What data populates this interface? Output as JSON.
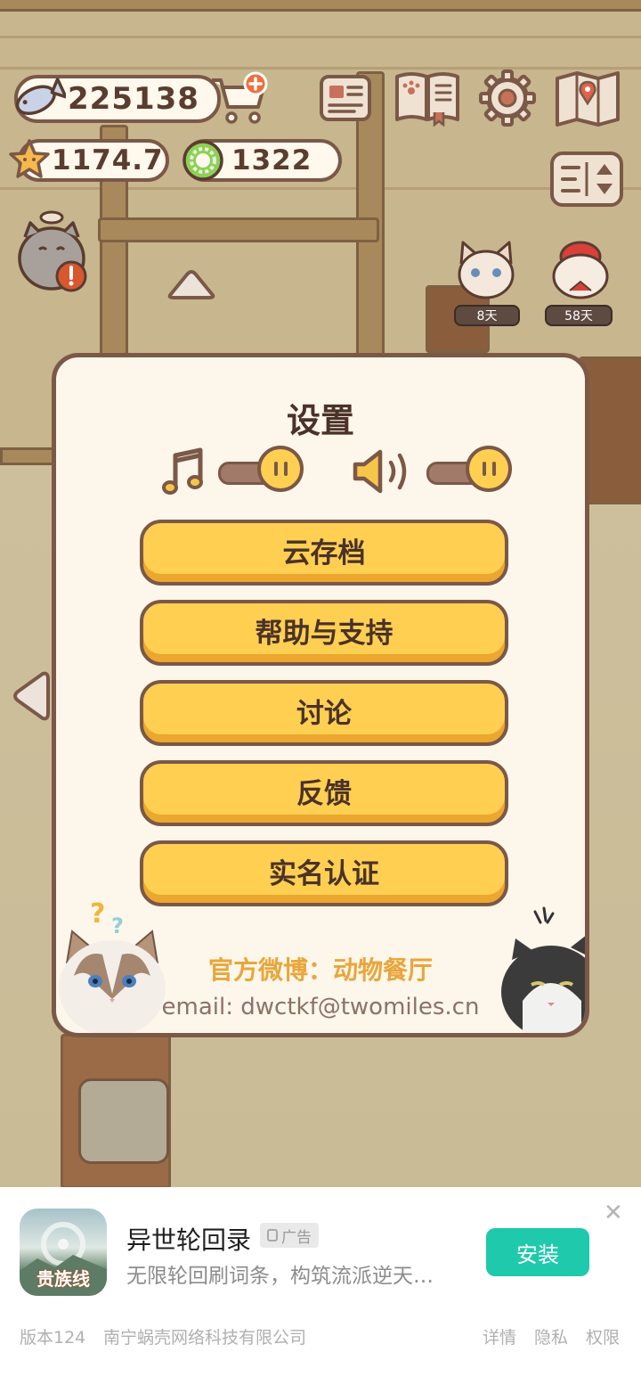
{
  "hud": {
    "fish_count": "225138",
    "star_count": "1174.7",
    "coin_count": "1322"
  },
  "characters": {
    "badge_1": "8天",
    "badge_2": "58天"
  },
  "dialog": {
    "title": "设置",
    "music_level": 1.0,
    "sound_level": 1.0,
    "buttons": [
      "云存档",
      "帮助与支持",
      "讨论",
      "反馈",
      "实名认证"
    ],
    "weibo": "官方微博：动物餐厅",
    "email": "email: dwctkf@twomiles.cn"
  },
  "ad": {
    "app_icon_text": "贵族线",
    "title": "异世轮回录",
    "badge": "广告",
    "description": "无限轮回刷词条，构筑流派逆天…",
    "install_label": "安装",
    "version": "版本124",
    "company": "南宁蜗壳网络科技有限公司",
    "links": [
      "详情",
      "隐私",
      "权限"
    ]
  },
  "colors": {
    "accent_yellow": "#ffcf52",
    "outline_brown": "#7b5847",
    "panel_cream": "#fdf6ea",
    "install_green": "#1fc9ac",
    "weibo_orange": "#e8a63a"
  }
}
